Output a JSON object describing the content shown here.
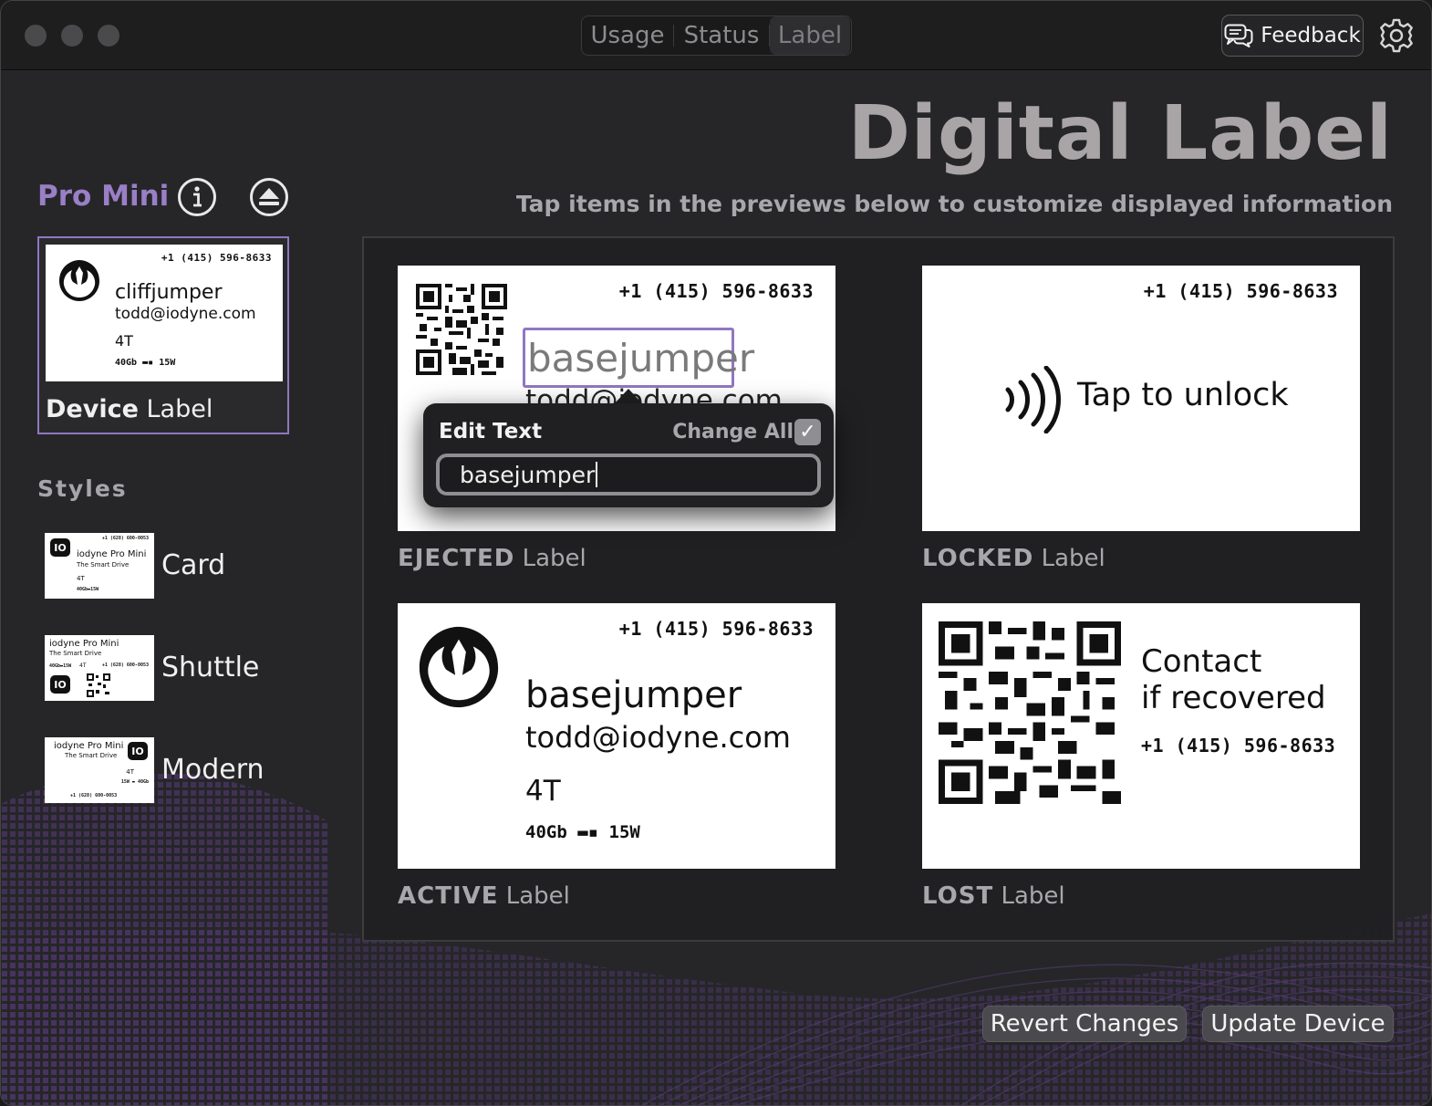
{
  "titlebar": {
    "tabs": [
      {
        "label": "Usage",
        "selected": false
      },
      {
        "label": "Status",
        "selected": false
      },
      {
        "label": "Label",
        "selected": true
      }
    ],
    "feedback_label": "Feedback"
  },
  "header": {
    "title": "Digital Label",
    "subtitle": "Tap items in the previews below to customize displayed information"
  },
  "sidebar": {
    "device_name": "Pro Mini",
    "device_label": {
      "caption_bold": "Device",
      "caption_rest": " Label",
      "phone": "+1 (415) 596-8633",
      "name": "cliffjumper",
      "email": "todd@iodyne.com",
      "capacity": "4T",
      "specs": "40Gb",
      "power": "15W"
    },
    "styles_heading": "Styles",
    "styles": [
      {
        "name": "Card",
        "logo": "IO",
        "phone": "+1 (628) 600-0053",
        "product": "iodyne Pro Mini",
        "tagline": "The Smart Drive",
        "capacity": "4T",
        "specs": "40Gb",
        "power": "15W"
      },
      {
        "name": "Shuttle",
        "logo": "IO",
        "product": "iodyne Pro Mini",
        "tagline": "The Smart Drive",
        "specs": "40Gb",
        "power": "15W",
        "capacity": "4T",
        "phone": "+1 (628) 600-0053"
      },
      {
        "name": "Modern",
        "logo": "IO",
        "product": "iodyne Pro Mini",
        "tagline": "The Smart Drive",
        "capacity": "4T",
        "power": "15W",
        "specs": "40Gb",
        "phone": "+1 (628) 600-0053"
      }
    ]
  },
  "previews": {
    "ejected": {
      "caption_bold": "EJECTED",
      "caption_rest": " Label",
      "phone": "+1 (415) 596-8633",
      "name": "basejumper",
      "email": "todd@iodyne.com"
    },
    "locked": {
      "caption_bold": "LOCKED",
      "caption_rest": " Label",
      "phone": "+1 (415) 596-8633",
      "message": "Tap to unlock"
    },
    "active": {
      "caption_bold": "ACTIVE",
      "caption_rest": " Label",
      "phone": "+1 (415) 596-8633",
      "name": "basejumper",
      "email": "todd@iodyne.com",
      "capacity": "4T",
      "specs": "40Gb",
      "power": "15W"
    },
    "lost": {
      "caption_bold": "LOST",
      "caption_rest": " Label",
      "line1": "Contact",
      "line2": "if recovered",
      "phone": "+1 (415) 596-8633"
    }
  },
  "edit_popover": {
    "title": "Edit Text",
    "change_all_label": "Change All",
    "change_all_checked": true,
    "value": "basejumper"
  },
  "actions": {
    "revert_label": "Revert Changes",
    "update_label": "Update Device"
  },
  "colors": {
    "accent": "#9a7fc7",
    "selection_border": "#9077c0",
    "background": "#262628",
    "button": "#4a4a4e"
  }
}
